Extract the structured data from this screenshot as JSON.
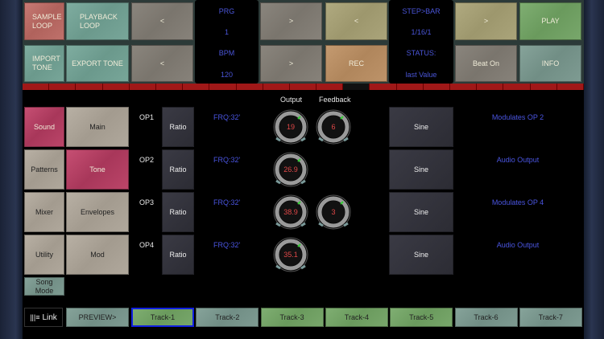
{
  "top": {
    "sample_loop": "SAMPLE LOOP",
    "playback_loop": "PLAYBACK LOOP",
    "import_tone": "IMPORT TONE",
    "export_tone": "EXPORT TONE",
    "prev1": "<",
    "prev2": "<",
    "next1": ">",
    "next2": ">",
    "prg_label": "PRG",
    "prg_value": "1",
    "bpm_label": "BPM",
    "bpm_value": "120",
    "step_prev": "<",
    "step_next": ">",
    "rec": "REC",
    "stepbar_label": "STEP>BAR",
    "stepbar_value": "1/16/1",
    "status_label": "STATUS:",
    "status_value": "last Value",
    "beat": "Beat On",
    "play": "PLAY",
    "info": "INFO"
  },
  "menu": {
    "sound": "Sound",
    "main": "Main",
    "patterns": "Patterns",
    "tone": "Tone",
    "mixer": "Mixer",
    "envelopes": "Envelopes",
    "utility": "Utility",
    "mod": "Mod",
    "song_mode": "Song Mode"
  },
  "ops": {
    "output_label": "Output",
    "feedback_label": "Feedback",
    "rows": [
      {
        "name": "OP1",
        "ratio": "Ratio",
        "frq": "FRQ:32'",
        "output": "19",
        "feedback": "6",
        "wave": "Sine",
        "route": "Modulates OP 2"
      },
      {
        "name": "OP2",
        "ratio": "Ratio",
        "frq": "FRQ:32'",
        "output": "26.9",
        "wave": "Sine",
        "route": "Audio Output"
      },
      {
        "name": "OP3",
        "ratio": "Ratio",
        "frq": "FRQ:32'",
        "output": "38.9",
        "feedback": "3",
        "wave": "Sine",
        "route": "Modulates OP 4"
      },
      {
        "name": "OP4",
        "ratio": "Ratio",
        "frq": "FRQ:32'",
        "output": "35.1",
        "wave": "Sine",
        "route": "Audio Output"
      }
    ]
  },
  "bottom": {
    "link": "Link",
    "preview": "PREVIEW>",
    "tracks": [
      "Track-1",
      "Track-2",
      "Track-3",
      "Track-4",
      "Track-5",
      "Track-6",
      "Track-7"
    ],
    "selected_track": "Track-1"
  }
}
